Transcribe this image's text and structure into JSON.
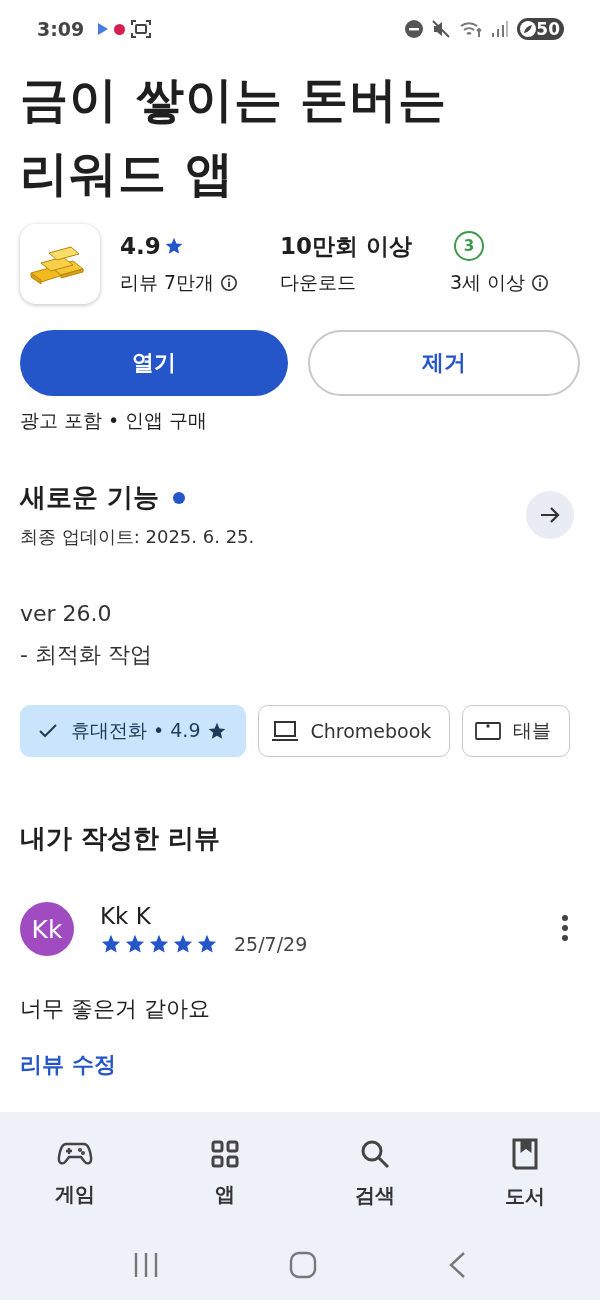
{
  "status_bar": {
    "time": "3:09",
    "battery": "50"
  },
  "app": {
    "title": "금이 쌓이는 돈버는 리워드 앱"
  },
  "stats": {
    "rating": "4.9",
    "reviews": "리뷰 7만개",
    "downloads": "10만회 이상",
    "downloads_label": "다운로드",
    "age_badge": "3",
    "age_rating": "3세 이상"
  },
  "buttons": {
    "open": "열기",
    "uninstall": "제거"
  },
  "disclaimer": "광고 포함 • 인앱 구매",
  "whats_new": {
    "title": "새로운 기능",
    "updated": "최종 업데이트: 2025. 6. 25.",
    "version": "ver 26.0",
    "notes": "- 최적화 작업"
  },
  "device_chips": [
    {
      "kind": "phone",
      "label": "휴대전화 • 4.9",
      "selected": true
    },
    {
      "kind": "laptop",
      "label": "Chromebook",
      "selected": false
    },
    {
      "kind": "tablet",
      "label": "태블",
      "selected": false
    }
  ],
  "my_review": {
    "heading": "내가 작성한 리뷰",
    "avatar": "Kk",
    "author": "Kk K",
    "stars": 5,
    "date": "25/7/29",
    "text": "너무 좋은거 같아요",
    "edit_link": "리뷰 수정"
  },
  "bottom_nav": [
    {
      "kind": "games",
      "label": "게임"
    },
    {
      "kind": "apps",
      "label": "앱"
    },
    {
      "kind": "search",
      "label": "검색"
    },
    {
      "kind": "books",
      "label": "도서"
    }
  ]
}
